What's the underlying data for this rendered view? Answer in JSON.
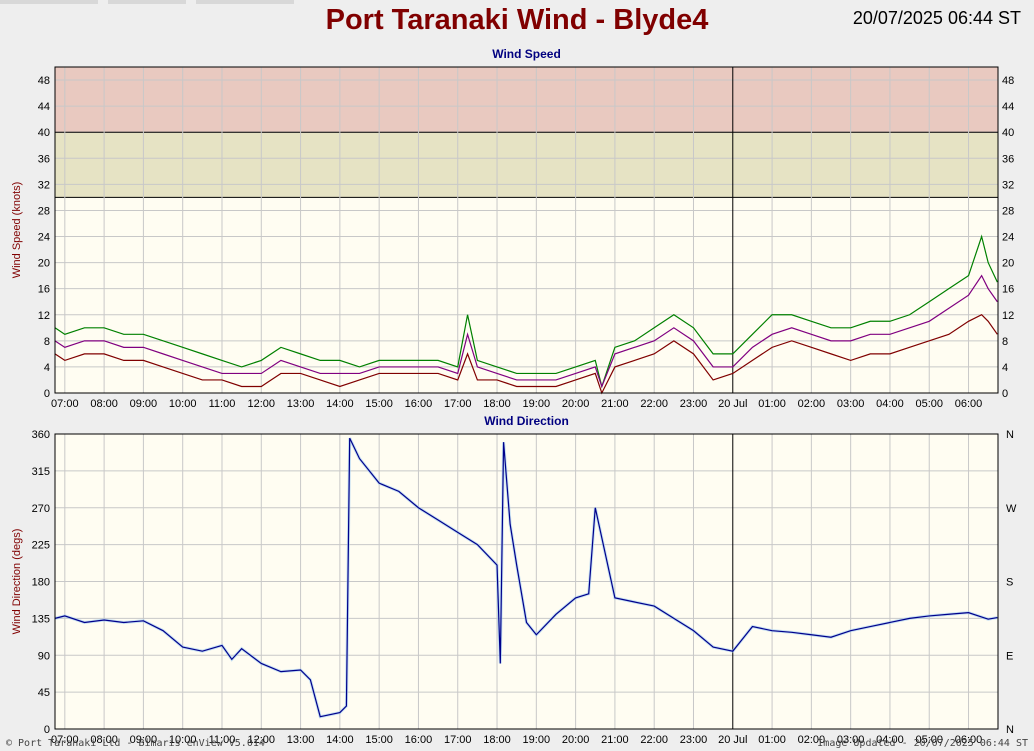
{
  "header": {
    "title": "Port Taranaki Wind - Blyde4",
    "timestamp": "20/07/2025 06:44 ST"
  },
  "footer": {
    "left": "© Port Taranaki Ltd - Bimaris enView V5.014",
    "right": "Image Updated - 20/07/2025 06:44 ST"
  },
  "colors": {
    "plot_bg": "#fffdf2",
    "danger_band": "#e9c9c0",
    "warning_band": "#e6e3c4",
    "gust": "#008000",
    "mean": "#800080",
    "lull": "#800000",
    "direction": "#00008b",
    "direction_light": "#9ecbf4"
  },
  "x_ticks": [
    "07:00",
    "08:00",
    "09:00",
    "10:00",
    "11:00",
    "12:00",
    "13:00",
    "14:00",
    "15:00",
    "16:00",
    "17:00",
    "18:00",
    "19:00",
    "20:00",
    "21:00",
    "22:00",
    "23:00",
    "20 Jul",
    "01:00",
    "02:00",
    "03:00",
    "04:00",
    "05:00",
    "06:00"
  ],
  "chart_data": [
    {
      "type": "line",
      "title": "Wind Speed",
      "ylabel": "Wind Speed (knots)",
      "ylim": [
        0,
        50
      ],
      "y_ticks": [
        0,
        4,
        8,
        12,
        16,
        20,
        24,
        28,
        32,
        36,
        40,
        44,
        48
      ],
      "bands": [
        {
          "name": "warning",
          "from": 30,
          "to": 40
        },
        {
          "name": "danger",
          "from": 40,
          "to": 50
        }
      ],
      "x": [
        "06:45",
        "07:00",
        "07:30",
        "08:00",
        "08:30",
        "09:00",
        "09:30",
        "10:00",
        "10:30",
        "11:00",
        "11:30",
        "12:00",
        "12:30",
        "13:00",
        "13:30",
        "14:00",
        "14:30",
        "15:00",
        "15:30",
        "16:00",
        "16:30",
        "17:00",
        "17:15",
        "17:30",
        "18:00",
        "18:30",
        "19:00",
        "19:30",
        "20:00",
        "20:30",
        "20:40",
        "21:00",
        "21:30",
        "22:00",
        "22:30",
        "23:00",
        "23:30",
        "00:00",
        "00:30",
        "01:00",
        "01:30",
        "02:00",
        "02:30",
        "03:00",
        "03:30",
        "04:00",
        "04:30",
        "05:00",
        "05:30",
        "06:00",
        "06:20",
        "06:30",
        "06:44"
      ],
      "series": [
        {
          "values": [
            10,
            9,
            10,
            10,
            9,
            9,
            8,
            7,
            6,
            5,
            4,
            5,
            7,
            6,
            5,
            5,
            4,
            5,
            5,
            5,
            5,
            4,
            12,
            5,
            4,
            3,
            3,
            3,
            4,
            5,
            1,
            7,
            8,
            10,
            12,
            10,
            6,
            6,
            9,
            12,
            12,
            11,
            10,
            10,
            11,
            11,
            12,
            14,
            16,
            18,
            24,
            20,
            17
          ]
        },
        {
          "values": [
            8,
            7,
            8,
            8,
            7,
            7,
            6,
            5,
            4,
            3,
            3,
            3,
            5,
            4,
            3,
            3,
            3,
            4,
            4,
            4,
            4,
            3,
            9,
            4,
            3,
            2,
            2,
            2,
            3,
            4,
            1,
            6,
            7,
            8,
            10,
            8,
            4,
            4,
            7,
            9,
            10,
            9,
            8,
            8,
            9,
            9,
            10,
            11,
            13,
            15,
            18,
            16,
            14
          ]
        },
        {
          "values": [
            6,
            5,
            6,
            6,
            5,
            5,
            4,
            3,
            2,
            2,
            1,
            1,
            3,
            3,
            2,
            1,
            2,
            3,
            3,
            3,
            3,
            2,
            6,
            2,
            2,
            1,
            1,
            1,
            2,
            3,
            0,
            4,
            5,
            6,
            8,
            6,
            2,
            3,
            5,
            7,
            8,
            7,
            6,
            5,
            6,
            6,
            7,
            8,
            9,
            11,
            12,
            11,
            9
          ]
        }
      ]
    },
    {
      "type": "line",
      "title": "Wind Direction",
      "ylabel": "Wind Direction (degs)",
      "ylim": [
        0,
        360
      ],
      "y_ticks": [
        0,
        45,
        90,
        135,
        180,
        225,
        270,
        315,
        360
      ],
      "y_right_ticks": [
        "N",
        "W",
        "S",
        "E",
        "N"
      ],
      "x": [
        "06:45",
        "07:00",
        "07:30",
        "08:00",
        "08:30",
        "09:00",
        "09:30",
        "10:00",
        "10:30",
        "11:00",
        "11:15",
        "11:30",
        "12:00",
        "12:30",
        "13:00",
        "13:15",
        "13:30",
        "14:00",
        "14:10",
        "14:15",
        "14:30",
        "15:00",
        "15:30",
        "16:00",
        "16:30",
        "17:00",
        "17:30",
        "18:00",
        "18:05",
        "18:10",
        "18:20",
        "18:30",
        "18:45",
        "19:00",
        "19:30",
        "20:00",
        "20:20",
        "20:30",
        "21:00",
        "21:30",
        "22:00",
        "22:30",
        "23:00",
        "23:30",
        "00:00",
        "00:30",
        "01:00",
        "01:30",
        "02:00",
        "02:30",
        "03:00",
        "03:30",
        "04:00",
        "04:30",
        "05:00",
        "05:30",
        "06:00",
        "06:30",
        "06:44"
      ],
      "series": [
        {
          "values": [
            135,
            138,
            130,
            133,
            130,
            132,
            120,
            100,
            95,
            102,
            85,
            98,
            80,
            70,
            72,
            60,
            15,
            20,
            28,
            355,
            330,
            300,
            290,
            270,
            255,
            240,
            225,
            200,
            80,
            350,
            250,
            200,
            130,
            115,
            140,
            160,
            165,
            270,
            160,
            155,
            150,
            135,
            120,
            100,
            95,
            125,
            120,
            118,
            115,
            112,
            120,
            125,
            130,
            135,
            138,
            140,
            142,
            134,
            136
          ]
        }
      ]
    }
  ]
}
